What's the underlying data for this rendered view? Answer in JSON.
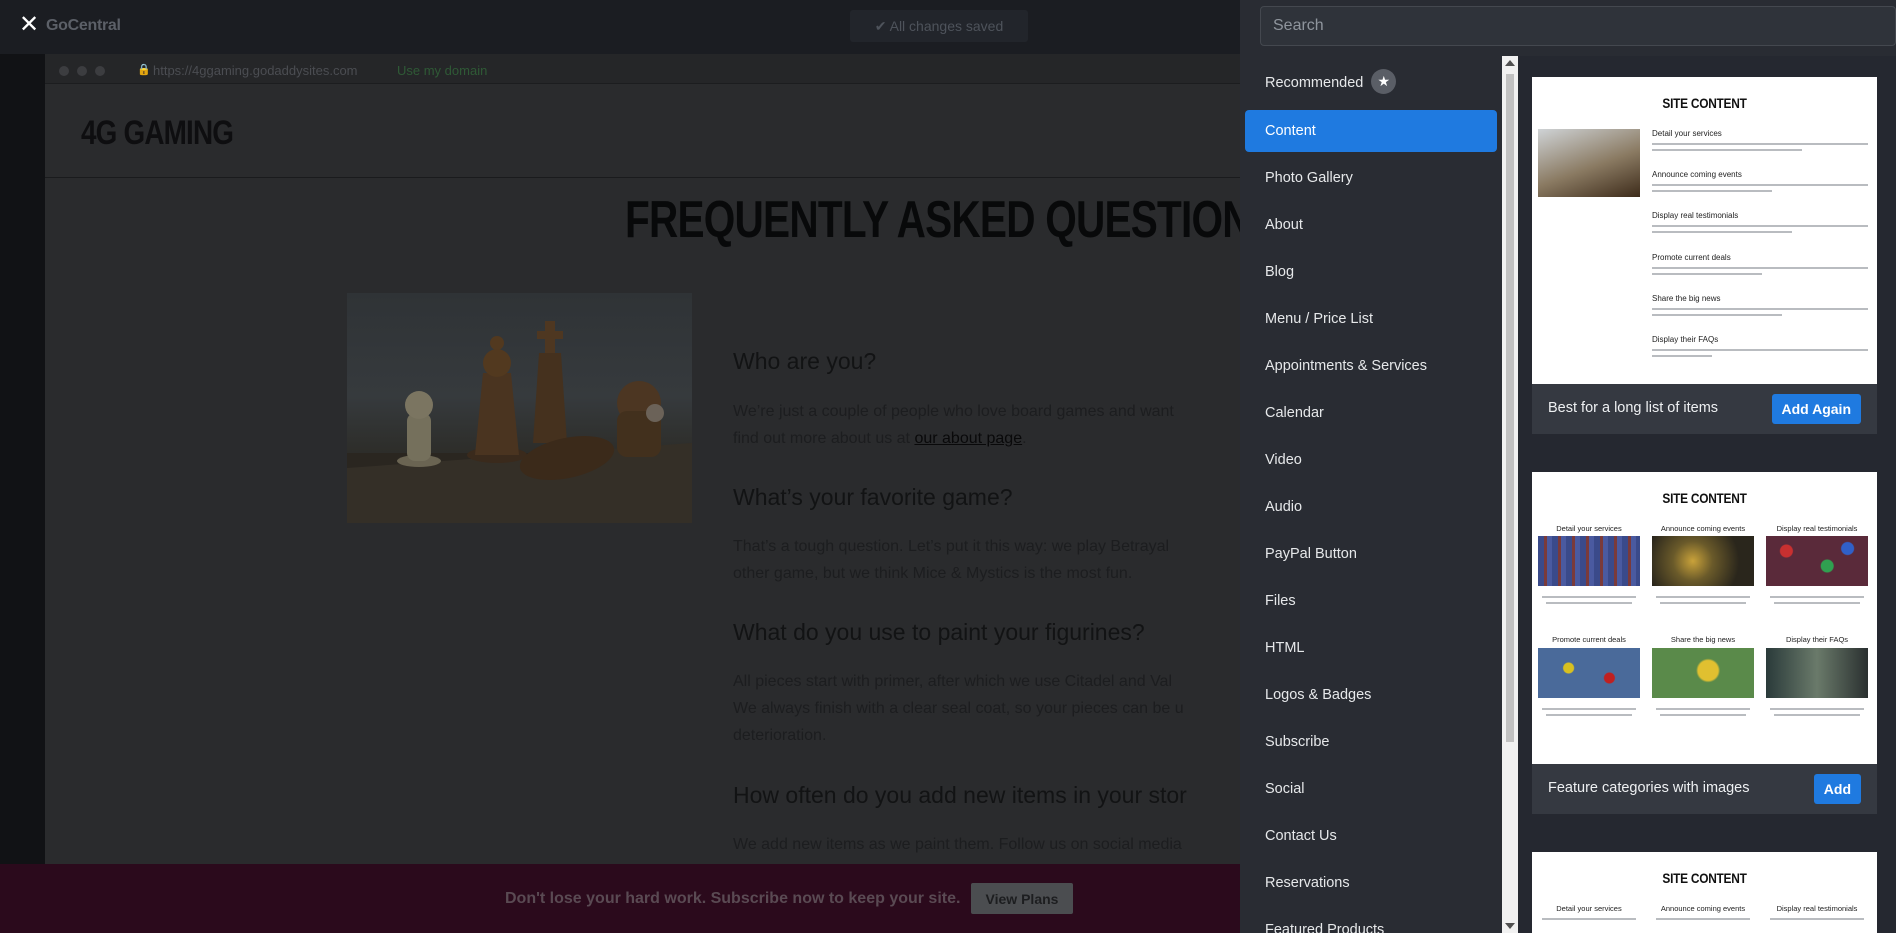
{
  "topbar": {
    "brand": "GoCentral",
    "saved_status": "All changes saved"
  },
  "preview": {
    "url": "https://4ggaming.godaddysites.com",
    "use_domain": "Use my domain",
    "site_title": "4G GAMING",
    "faq_title": "FREQUENTLY ASKED QUESTIONS",
    "faqs": [
      {
        "q": "Who are you?",
        "a1": "We’re just a couple of people who love board games and want",
        "a2_pre": "find out more about us at ",
        "a2_link": "our about page",
        "a2_post": "."
      },
      {
        "q": "What’s your favorite game?",
        "a1": "That’s a tough question. Let’s put it this way: we play Betrayal",
        "a2": "other game, but we think Mice & Mystics is the most fun."
      },
      {
        "q": "What do you use to paint your figurines?",
        "a1": "All pieces start with primer, after which we use Citadel and Val",
        "a2": "We always finish with a clear seal coat, so your pieces can be u",
        "a3": "deterioration."
      },
      {
        "q": "How often do you add new items in your stor",
        "a1": "We add new items as we paint them. Follow us on social media"
      }
    ]
  },
  "promo": {
    "text": "Don't lose your hard work. Subscribe now to keep your site.",
    "button": "View Plans"
  },
  "panel": {
    "search_placeholder": "Search",
    "categories": [
      "Recommended",
      "Content",
      "Photo Gallery",
      "About",
      "Blog",
      "Menu / Price List",
      "Appointments & Services",
      "Calendar",
      "Video",
      "Audio",
      "PayPal Button",
      "Files",
      "HTML",
      "Logos & Badges",
      "Subscribe",
      "Social",
      "Contact Us",
      "Reservations",
      "Featured Products"
    ],
    "active_category": "Content",
    "cards": [
      {
        "title": "SITE CONTENT",
        "headings": [
          "Detail your services",
          "Announce coming events",
          "Display real testimonials",
          "Promote current deals",
          "Share the big news",
          "Display their FAQs"
        ],
        "label": "Best for a long list of items",
        "button": "Add Again"
      },
      {
        "title": "SITE CONTENT",
        "headings": [
          "Detail your services",
          "Announce coming events",
          "Display real testimonials",
          "Promote current deals",
          "Share the big news",
          "Display their FAQs"
        ],
        "label": "Feature categories with images",
        "button": "Add"
      },
      {
        "title": "SITE CONTENT",
        "headings": [
          "Detail your services",
          "Announce coming events",
          "Display real testimonials"
        ]
      }
    ]
  },
  "colors": {
    "accent_blue": "#1f7ae0",
    "panel_bg": "#292c33",
    "promo_bg": "#2b0a1c"
  },
  "icons": [
    "close-icon",
    "lock-icon",
    "star-icon",
    "scroll-up-icon",
    "scroll-down-icon"
  ]
}
